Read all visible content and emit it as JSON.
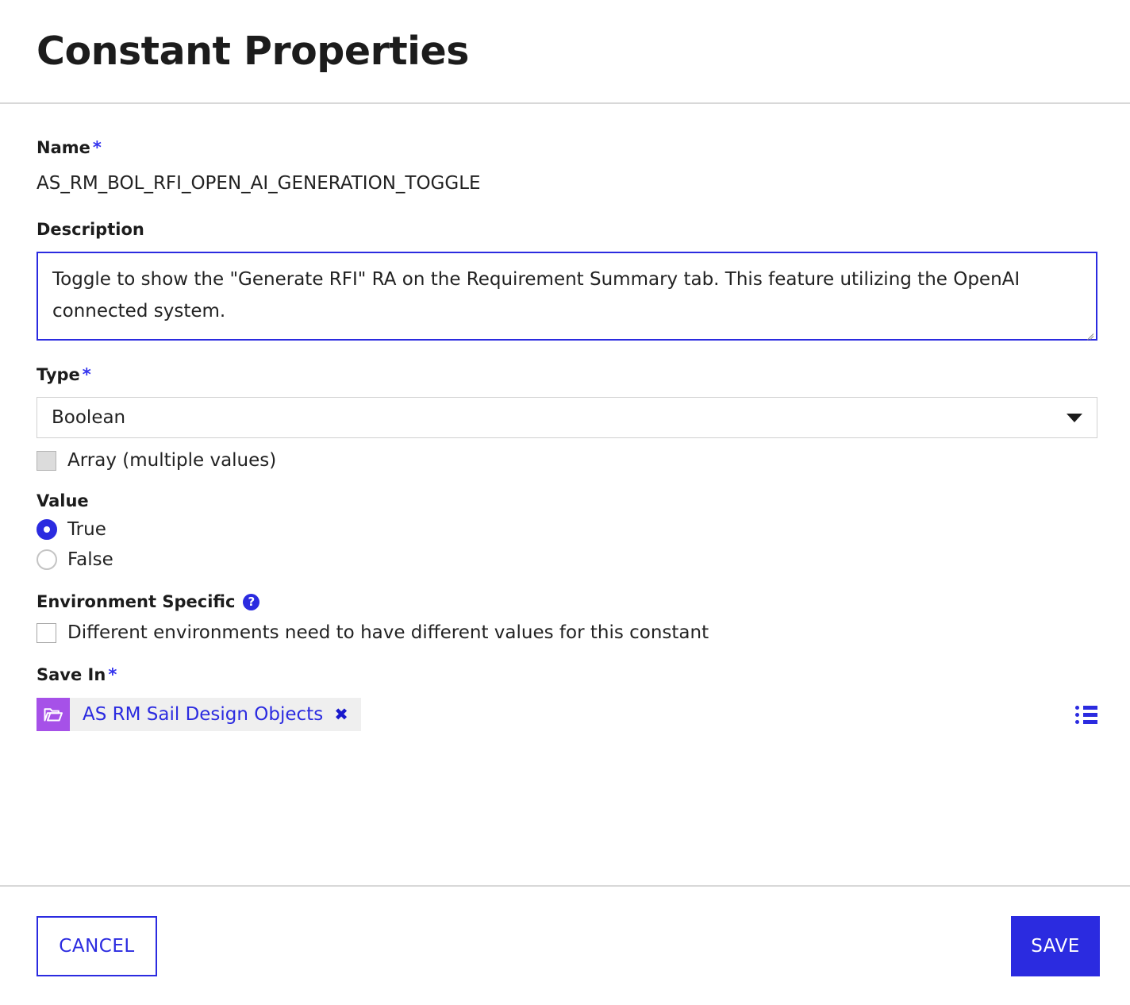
{
  "header": {
    "title": "Constant Properties"
  },
  "form": {
    "name": {
      "label": "Name",
      "required_marker": "*",
      "value": "AS_RM_BOL_RFI_OPEN_AI_GENERATION_TOGGLE"
    },
    "description": {
      "label": "Description",
      "value": "Toggle to show the \"Generate RFI\" RA on the Requirement Summary tab. This feature utilizing the OpenAI connected system.",
      "placeholder": ""
    },
    "type": {
      "label": "Type",
      "required_marker": "*",
      "selected": "Boolean",
      "options": [
        "Boolean"
      ],
      "array_checkbox": {
        "label": "Array (multiple values)",
        "checked": false,
        "disabled": true
      }
    },
    "value": {
      "label": "Value",
      "selected": "True",
      "options": [
        {
          "label": "True",
          "selected": true
        },
        {
          "label": "False",
          "selected": false
        }
      ]
    },
    "environment_specific": {
      "label": "Environment Specific",
      "help_icon": "help-circle-icon",
      "help_glyph": "?",
      "checkbox": {
        "label": "Different environments need to have different values for this constant",
        "checked": false
      }
    },
    "save_in": {
      "label": "Save In",
      "required_marker": "*",
      "chip": {
        "icon": "folder-open-icon",
        "text": "AS RM Sail Design Objects",
        "close_glyph": "✖"
      },
      "browse_icon": "bulleted-list-icon"
    }
  },
  "footer": {
    "cancel_label": "CANCEL",
    "save_label": "SAVE"
  },
  "colors": {
    "accent_blue": "#2b2be0",
    "folder_purple": "#a651e8",
    "divider_grey": "#d8d8d8",
    "chip_bg": "#efefef"
  }
}
